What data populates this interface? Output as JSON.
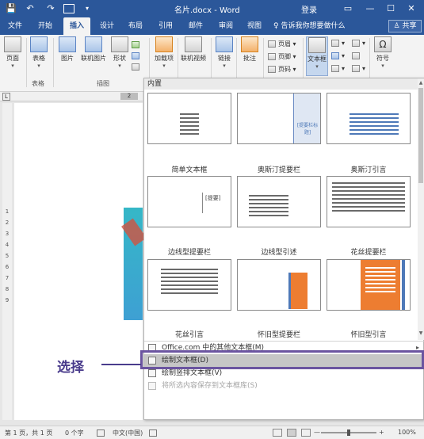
{
  "titlebar": {
    "title": "名片.docx - Word",
    "login": "登录",
    "undo_icon": "↶",
    "redo_icon": "↷",
    "save_icon": "💾",
    "min": "—",
    "max": "☐",
    "close": "✕",
    "ribbon_opts": "▭"
  },
  "tabs": {
    "items": [
      "文件",
      "开始",
      "插入",
      "设计",
      "布局",
      "引用",
      "邮件",
      "审阅",
      "视图"
    ],
    "active": "插入",
    "tell": "♀ 告诉我你想要做什么",
    "share": "♙ 共享"
  },
  "ribbon": {
    "page": "页面",
    "table": "表格",
    "pictures": "图片",
    "online_pictures": "联机图片",
    "shapes": "形状",
    "addins": "加载项",
    "online_video": "联机视频",
    "link": "链接",
    "comment": "批注",
    "header": "页眉",
    "footer": "页脚",
    "page_number": "页码",
    "textbox": "文本框",
    "symbol": "符号",
    "group_table": "表格",
    "group_illustrations": "插图"
  },
  "gallery": {
    "header": "内置",
    "tiles": [
      {
        "label": "简单文本框"
      },
      {
        "label": "奥斯汀提要栏"
      },
      {
        "label": "奥斯汀引言"
      },
      {
        "label": "边线型提要栏"
      },
      {
        "label": "边线型引述"
      },
      {
        "label": "花丝提要栏"
      },
      {
        "label": "花丝引言"
      },
      {
        "label": "怀旧型提要栏"
      },
      {
        "label": "怀旧型引言"
      }
    ],
    "thumb_text": {
      "austin_sidebar": "[提要栏标题]",
      "sideline": "[提要]"
    }
  },
  "menu": {
    "more_online": "Office.com 中的其他文本框(M)",
    "draw_textbox": "绘制文本框(D)",
    "draw_vertical": "绘制竖排文本框(V)",
    "save_selection": "将所选内容保存到文本框库(S)"
  },
  "callout": {
    "label": "选择"
  },
  "ruler": {
    "corner": "L",
    "top_mark": "2",
    "left_nums": [
      "1",
      "2",
      "3",
      "4",
      "5",
      "6",
      "7",
      "8",
      "9"
    ]
  },
  "status": {
    "page": "第 1 页，共 1 页",
    "words": "0 个字",
    "lang": "中文(中国)",
    "zoom": "100%",
    "zoom_minus": "—",
    "zoom_plus": "+"
  },
  "colors": {
    "brand": "#2b579a",
    "callout": "#6b54a0",
    "orange": "#ed7d31",
    "teal": "#35b7c7"
  }
}
